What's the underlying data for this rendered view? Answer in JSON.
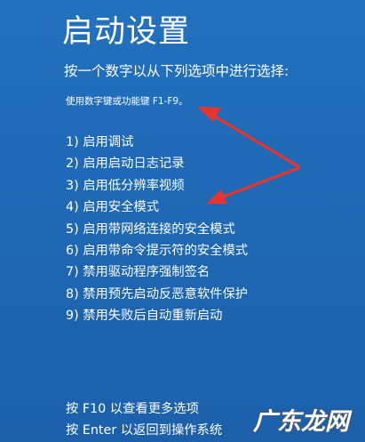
{
  "screen": {
    "title": "启动设置",
    "prompt": "按一个数字以从下列选项中进行选择:",
    "hint": "使用数字键或功能键 F1-F9。"
  },
  "options": [
    "1) 启用调试",
    "2) 启用启动日志记录",
    "3) 启用低分辨率视频",
    "4) 启用安全模式",
    "5) 启用带网络连接的安全模式",
    "6) 启用带命令提示符的安全模式",
    "7) 禁用驱动程序强制签名",
    "8) 禁用预先启动反恶意软件保护",
    "9) 禁用失败后自动重新启动"
  ],
  "footer": {
    "more_options": "按 F10 以查看更多选项",
    "return_os": "按 Enter 以返回到操作系统"
  },
  "watermark": {
    "text": "广东龙网"
  },
  "colors": {
    "background": "#1f6bb8",
    "text": "#ffffff",
    "annotation_arrow": "#e8342f"
  }
}
